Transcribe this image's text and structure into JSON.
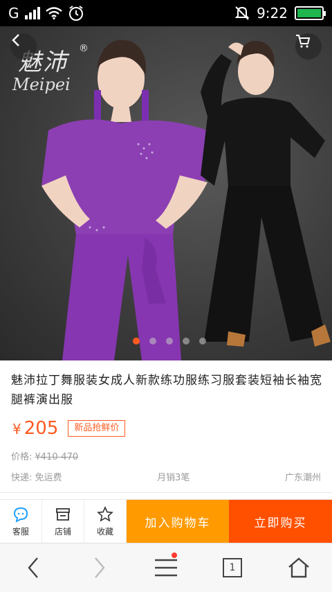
{
  "status_bar": {
    "network": "G",
    "time": "9:22"
  },
  "hero": {
    "brand_cn": "魅沛",
    "brand_reg": "®",
    "brand_en": "Meipei",
    "slide_count": 5,
    "active_slide": 0,
    "back_icon": "chevron-left-icon",
    "cart_icon": "cart-icon"
  },
  "product": {
    "title": "魅沛拉丁舞服装女成人新款练功服练习服套装短袖长袖宽腿裤演出服",
    "price_symbol": "¥",
    "price": "205",
    "badge": "新品抢鲜价",
    "original_label": "价格:",
    "original_price": "¥410-470",
    "shipping": "快递: 免运费",
    "monthly_sales": "月销3笔",
    "location": "广东潮州"
  },
  "action_bar": {
    "service_label": "客服",
    "shop_label": "店铺",
    "favorite_label": "收藏",
    "add_to_cart": "加入购物车",
    "buy_now": "立即购买"
  },
  "browser_nav": {
    "tab_count": "1"
  },
  "colors": {
    "accent_orange": "#ff5a1f",
    "add_cart_bg": "#ff9a00",
    "buy_now_bg": "#ff5000",
    "battery_green": "#1fb64f"
  }
}
